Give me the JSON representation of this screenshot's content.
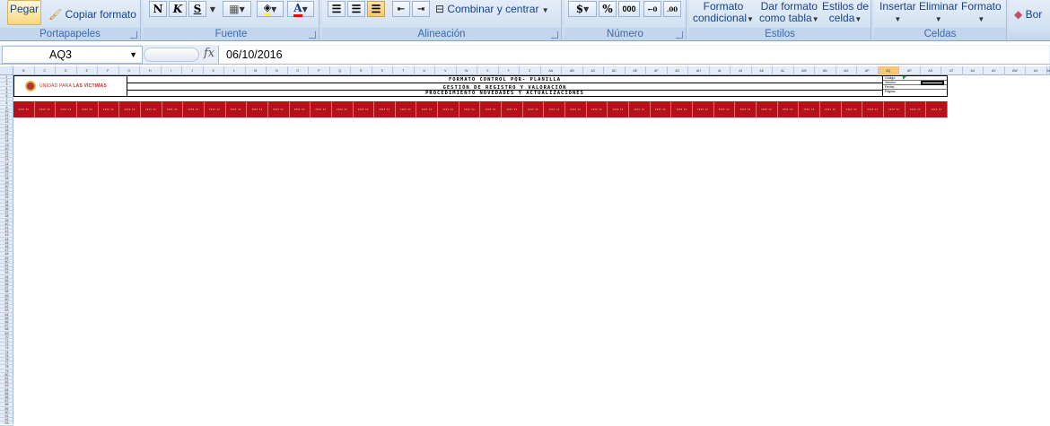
{
  "ribbon": {
    "portapapeles": {
      "pegar": "Pegar",
      "copiar_formato": "Copiar formato",
      "label": "Portapapeles"
    },
    "fuente": {
      "bold": "N",
      "italic": "K",
      "underline": "S",
      "label": "Fuente",
      "font_color_letter": "A"
    },
    "alineacion": {
      "combinar": "Combinar y centrar",
      "label": "Alineación"
    },
    "numero": {
      "currency": "$",
      "percent": "%",
      "thousands": "000",
      "label": "Número"
    },
    "estilos": {
      "formato_condicional_1": "Formato",
      "formato_condicional_2": "condicional",
      "dar_formato_1": "Dar formato",
      "dar_formato_2": "como tabla",
      "estilos_celda_1": "Estilos de",
      "estilos_celda_2": "celda",
      "label": "Estilos"
    },
    "celdas": {
      "insertar": "Insertar",
      "eliminar": "Eliminar",
      "formato": "Formato",
      "label": "Celdas"
    },
    "partial": {
      "borrar": "Bor"
    }
  },
  "formula_bar": {
    "name_box": "AQ3",
    "fx": "fx",
    "content": "06/10/2016"
  },
  "sheet": {
    "logo": {
      "text_prefix": "UNIDAD PARA ",
      "text_bold": "LAS VÍCTIMAS"
    },
    "title_lines": [
      "FORMATO CONTROL PQR- PLANILLA",
      "GESTIÓN DE REGISTRO Y VALORACIÓN",
      "PROCEDIMIENTO NOVEDADES Y ACTUALIZACIONES"
    ],
    "selected_column": "AQ",
    "selected_cell": "AQ3",
    "header_fill_color": "#b3121a",
    "meta_rows": [
      "Código:",
      "Versión:",
      "Fecha:",
      "Página:"
    ],
    "red_header_count": 44
  }
}
